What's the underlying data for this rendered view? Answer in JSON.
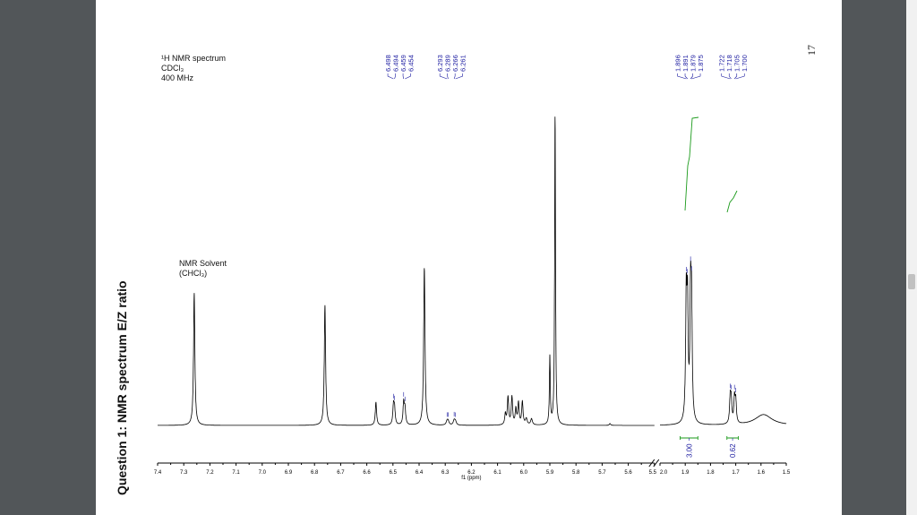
{
  "document": {
    "page_number": "17",
    "question_title": "Question 1: NMR spectrum E/Z ratio",
    "header": {
      "line1": "¹H NMR spectrum",
      "line2": "CDCl₃",
      "line3": "400 MHz"
    },
    "solvent_note": {
      "line1": "NMR Solvent",
      "line2": "(CHCl₃)"
    }
  },
  "chart_data": {
    "type": "line",
    "title": "¹H NMR spectrum",
    "xlabel": "f1 (ppm)",
    "axis_break": [
      5.5,
      2.0
    ],
    "segments": [
      {
        "xlim": [
          7.4,
          5.5
        ]
      },
      {
        "xlim": [
          2.0,
          1.5
        ]
      }
    ],
    "ticks_left": [
      "7.4",
      "7.3",
      "7.2",
      "7.1",
      "7.0",
      "6.9",
      "6.8",
      "6.7",
      "6.6",
      "6.5",
      "6.4",
      "6.3",
      "6.2",
      "6.1",
      "6.0",
      "5.9",
      "5.8",
      "5.7",
      "5.6",
      "5.5"
    ],
    "ticks_right": [
      "2.0",
      "1.9",
      "1.8",
      "1.7",
      "1.6",
      "1.5"
    ],
    "peaks": [
      {
        "ppm": 7.26,
        "intensity": 0.43,
        "width": 0.003
      },
      {
        "ppm": 6.76,
        "intensity": 0.39,
        "width": 0.003
      },
      {
        "ppm": 6.565,
        "intensity": 0.075,
        "width": 0.003
      },
      {
        "ppm": 6.498,
        "intensity": 0.06,
        "width": 0.003
      },
      {
        "ppm": 6.494,
        "intensity": 0.05,
        "width": 0.003
      },
      {
        "ppm": 6.459,
        "intensity": 0.07,
        "width": 0.003
      },
      {
        "ppm": 6.454,
        "intensity": 0.05,
        "width": 0.003
      },
      {
        "ppm": 6.38,
        "intensity": 0.51,
        "width": 0.003
      },
      {
        "ppm": 6.293,
        "intensity": 0.012,
        "width": 0.004
      },
      {
        "ppm": 6.289,
        "intensity": 0.012,
        "width": 0.004
      },
      {
        "ppm": 6.266,
        "intensity": 0.015,
        "width": 0.004
      },
      {
        "ppm": 6.261,
        "intensity": 0.012,
        "width": 0.004
      },
      {
        "ppm": 6.07,
        "intensity": 0.035,
        "width": 0.003
      },
      {
        "ppm": 6.06,
        "intensity": 0.09,
        "width": 0.003
      },
      {
        "ppm": 6.045,
        "intensity": 0.09,
        "width": 0.003
      },
      {
        "ppm": 6.03,
        "intensity": 0.05,
        "width": 0.003
      },
      {
        "ppm": 6.02,
        "intensity": 0.07,
        "width": 0.003
      },
      {
        "ppm": 6.005,
        "intensity": 0.075,
        "width": 0.003
      },
      {
        "ppm": 5.99,
        "intensity": 0.02,
        "width": 0.004
      },
      {
        "ppm": 5.97,
        "intensity": 0.02,
        "width": 0.004
      },
      {
        "ppm": 5.9,
        "intensity": 0.22,
        "width": 0.002
      },
      {
        "ppm": 5.88,
        "intensity": 1.0,
        "width": 0.002
      },
      {
        "ppm": 5.67,
        "intensity": 0.006,
        "width": 0.003
      },
      {
        "ppm": 1.896,
        "intensity": 0.38,
        "width": 0.003
      },
      {
        "ppm": 1.891,
        "intensity": 0.35,
        "width": 0.003
      },
      {
        "ppm": 1.879,
        "intensity": 0.37,
        "width": 0.003
      },
      {
        "ppm": 1.875,
        "intensity": 0.34,
        "width": 0.003
      },
      {
        "ppm": 1.722,
        "intensity": 0.08,
        "width": 0.003
      },
      {
        "ppm": 1.718,
        "intensity": 0.07,
        "width": 0.003
      },
      {
        "ppm": 1.705,
        "intensity": 0.08,
        "width": 0.003
      },
      {
        "ppm": 1.7,
        "intensity": 0.07,
        "width": 0.003
      },
      {
        "ppm": 1.59,
        "intensity": 0.035,
        "width": 0.04
      }
    ],
    "peak_label_groups": [
      [
        "6.498",
        "6.494",
        "6.459",
        "6.454"
      ],
      [
        "6.293",
        "6.289",
        "6.266",
        "6.261"
      ],
      [
        "1.896",
        "1.891",
        "1.879",
        "1.875"
      ],
      [
        "1.722",
        "1.718",
        "1.705",
        "1.700"
      ]
    ],
    "integrals": [
      {
        "from": 1.92,
        "to": 1.85,
        "value": "3.00"
      },
      {
        "from": 1.735,
        "to": 1.69,
        "value": "0.62"
      }
    ],
    "colors": {
      "spectrum": "#000000",
      "labels": "#1a1aa0",
      "integral": "#1a9a1a"
    }
  }
}
